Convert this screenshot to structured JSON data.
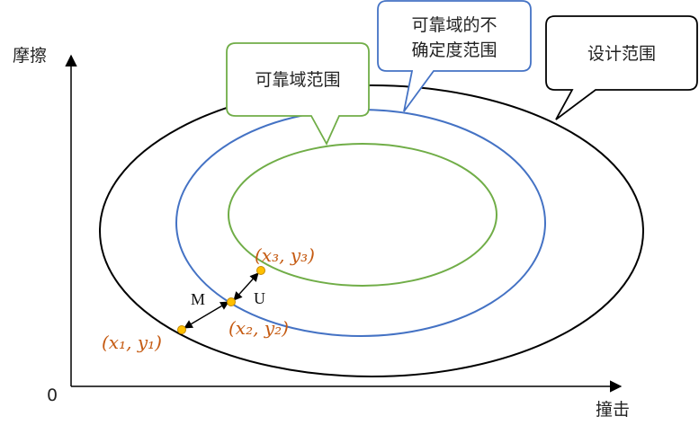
{
  "axes": {
    "y_label": "摩擦",
    "x_label": "撞击",
    "origin_label": "0"
  },
  "callouts": {
    "reliable": "可靠域范围",
    "uncertainty_line1": "可靠域的不",
    "uncertainty_line2": "确定度范围",
    "design": "设计范围"
  },
  "points": {
    "p1": "(x₁, y₁)",
    "p2": "(x₂, y₂)",
    "p3": "(x₃, y₃)"
  },
  "segments": {
    "m": "M",
    "u": "U"
  },
  "colors": {
    "design_ellipse": "#000000",
    "uncertainty_ellipse": "#4472c4",
    "reliable_ellipse": "#70ad47",
    "point_fill": "#ffc000",
    "point_label": "#c55a11"
  }
}
